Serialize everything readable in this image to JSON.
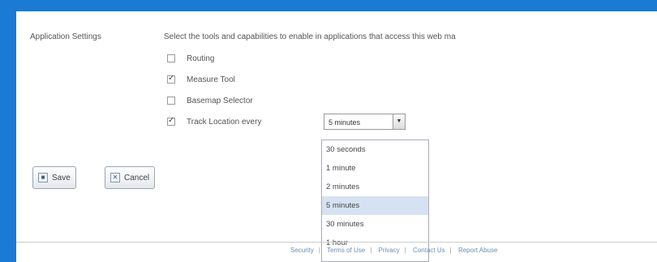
{
  "settings": {
    "section_label": "Application Settings",
    "instructions": "Select the tools and capabilities to enable in applications that access this web ma",
    "options": [
      {
        "label": "Routing",
        "checked": false
      },
      {
        "label": "Measure Tool",
        "checked": true
      },
      {
        "label": "Basemap Selector",
        "checked": false
      },
      {
        "label": "Track Location every",
        "checked": true
      }
    ],
    "interval": {
      "value": "5 minutes",
      "options": [
        "30 seconds",
        "1 minute",
        "2 minutes",
        "5 minutes",
        "30 minutes",
        "1 hour"
      ]
    }
  },
  "buttons": {
    "save": "Save",
    "cancel": "Cancel"
  },
  "footer": {
    "links": [
      "Security",
      "Terms of Use",
      "Privacy",
      "Contact Us",
      "Report Abuse"
    ]
  }
}
